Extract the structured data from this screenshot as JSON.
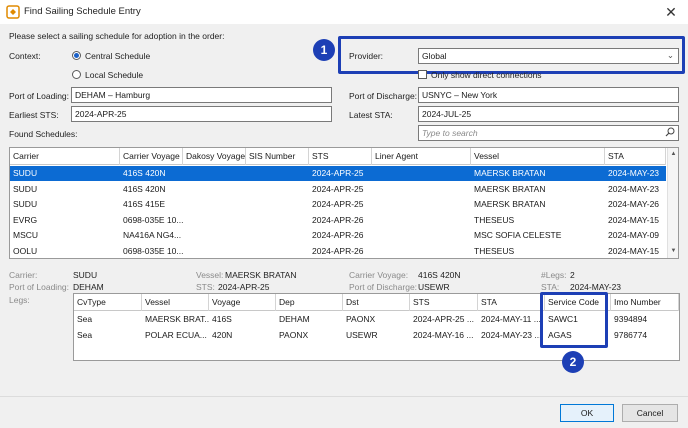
{
  "window": {
    "title": "Find Sailing Schedule Entry",
    "close_glyph": "✕"
  },
  "instruction": "Please select a sailing schedule for adoption in the order:",
  "context": {
    "label": "Context:",
    "options": [
      "Central Schedule",
      "Local Schedule"
    ],
    "selected": "Central Schedule"
  },
  "provider": {
    "label": "Provider:",
    "value": "Global",
    "direct_only_label": "Only show direct connections",
    "direct_only_checked": false
  },
  "port_of_loading": {
    "label": "Port of Loading:",
    "value": "DEHAM – Hamburg"
  },
  "port_of_discharge": {
    "label": "Port of Discharge:",
    "value": "USNYC – New York"
  },
  "earliest_sts": {
    "label": "Earliest STS:",
    "value": "2024-APR-25"
  },
  "latest_sta": {
    "label": "Latest STA:",
    "value": "2024-JUL-25"
  },
  "found_label": "Found Schedules:",
  "search": {
    "placeholder": "Type to search"
  },
  "schedules": {
    "columns": [
      "Carrier",
      "Carrier Voyage",
      "Dakosy Voyage",
      "SIS Number",
      "STS",
      "Liner Agent",
      "Vessel",
      "STA"
    ],
    "rows": [
      [
        "SUDU",
        "416S 420N",
        "",
        "",
        "2024-APR-25",
        "",
        "MAERSK BRATAN",
        "2024-MAY-23"
      ],
      [
        "SUDU",
        "416S 420N",
        "",
        "",
        "2024-APR-25",
        "",
        "MAERSK BRATAN",
        "2024-MAY-23"
      ],
      [
        "SUDU",
        "416S 415E",
        "",
        "",
        "2024-APR-25",
        "",
        "MAERSK BRATAN",
        "2024-MAY-26"
      ],
      [
        "EVRG",
        "0698-035E 10...",
        "",
        "",
        "2024-APR-26",
        "",
        "THESEUS",
        "2024-MAY-15"
      ],
      [
        "MSCU",
        "NA416A NG4...",
        "",
        "",
        "2024-APR-26",
        "",
        "MSC SOFIA CELESTE",
        "2024-MAY-09"
      ],
      [
        "OOLU",
        "0698-035E 10...",
        "",
        "",
        "2024-APR-26",
        "",
        "THESEUS",
        "2024-MAY-15"
      ]
    ],
    "selected_index": 0
  },
  "details": {
    "carrier_label": "Carrier:",
    "carrier": "SUDU",
    "vessel_label": "Vessel:",
    "vessel": "MAERSK BRATAN",
    "carrier_voyage_label": "Carrier Voyage:",
    "carrier_voyage": "416S 420N",
    "legs_count_label": "#Legs:",
    "legs_count": "2",
    "pol_label": "Port of Loading:",
    "pol": "DEHAM",
    "sts_label": "STS:",
    "sts": "2024-APR-25",
    "pod_label": "Port of Discharge:",
    "pod": "USEWR",
    "sta_label": "STA:",
    "sta": "2024-MAY-23",
    "legs_label": "Legs:"
  },
  "legs": {
    "columns": [
      "CvType",
      "Vessel",
      "Voyage",
      "Dep",
      "Dst",
      "STS",
      "STA",
      "Service Code",
      "Imo Number"
    ],
    "rows": [
      [
        "Sea",
        "MAERSK BRAT...",
        "416S",
        "DEHAM",
        "PAONX",
        "2024-APR-25 ...",
        "2024-MAY-11 ...",
        "SAWC1",
        "9394894"
      ],
      [
        "Sea",
        "POLAR ECUA...",
        "420N",
        "PAONX",
        "USEWR",
        "2024-MAY-16 ...",
        "2024-MAY-23 ...",
        "AGAS",
        "9786774"
      ]
    ]
  },
  "buttons": {
    "ok": "OK",
    "cancel": "Cancel"
  },
  "callouts": {
    "one": "1",
    "two": "2"
  },
  "colors": {
    "selection": "#0c6bd3",
    "callout": "#1d3fb5"
  }
}
